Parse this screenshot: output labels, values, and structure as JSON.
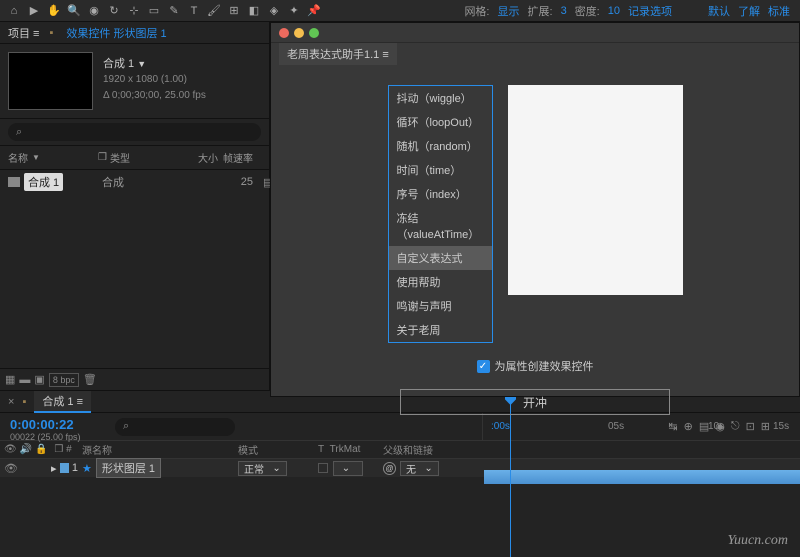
{
  "toolbar": {
    "grid_label": "网格:",
    "display_label": "显示",
    "expand_label": "扩展:",
    "expand_val": "3",
    "density_label": "密度:",
    "density_val": "10",
    "record_label": "记录选项",
    "default_label": "默认",
    "learn_label": "了解",
    "standard_label": "标准"
  },
  "project": {
    "tab_label": "项目 ≡",
    "effects_link": "效果控件 形状图层 1",
    "comp_name": "合成 1",
    "comp_res": "1920 x 1080 (1.00)",
    "comp_dur": "Δ 0;00;30;00, 25.00 fps",
    "headers": {
      "name": "名称",
      "type": "类型",
      "size": "大小",
      "fps": "帧速率"
    },
    "row": {
      "name": "合成 1",
      "type": "合成",
      "fps": "25"
    },
    "bpc": "8 bpc"
  },
  "dialog": {
    "title": "老周表达式助手1.1 ≡",
    "items": [
      "抖动（wiggle）",
      "循环（loopOut）",
      "随机（random）",
      "时间（time）",
      "序号（index）",
      "冻结（valueAtTime）",
      "自定义表达式",
      "使用帮助",
      "鸣谢与声明",
      "关于老周"
    ],
    "selected_index": 6,
    "checkbox_label": "为属性创建效果控件",
    "button_label": "开冲"
  },
  "timeline": {
    "tab": "合成 1 ≡",
    "timecode": "0:00:00:22",
    "frame_label": "00022 (25.00 fps)",
    "cols": {
      "num": "#",
      "sourcename": "源名称",
      "mode": "模式",
      "trkmat": "TrkMat",
      "parent": "父级和链接",
      "t": "T"
    },
    "layer": {
      "num": "1",
      "name": "形状图层 1",
      "mode": "正常",
      "parent": "无"
    },
    "ruler": {
      "m0": ":00s",
      "m1": "05s",
      "m2": "10s",
      "m3": "15s"
    }
  },
  "watermark": "Yuucn.com"
}
